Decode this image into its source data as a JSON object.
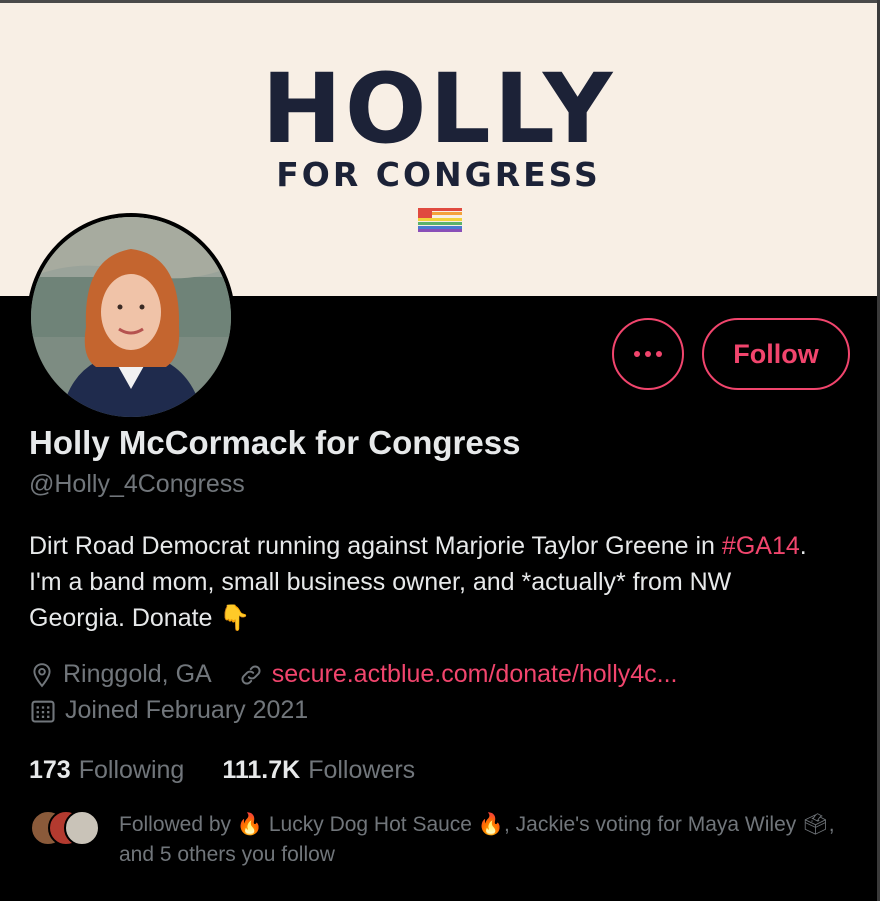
{
  "banner": {
    "title": "HOLLY",
    "subtitle": "FOR CONGRESS",
    "colors": {
      "text": "#1c2237",
      "background": "#f8efe5"
    }
  },
  "profile": {
    "name": "Holly McCormack for Congress",
    "handle": "@Holly_4Congress",
    "bio": {
      "part1": "Dirt Road Democrat running against Marjorie Taylor Greene in ",
      "hashtag": "#GA14",
      "part2": ". I'm a band mom, small business owner, and *actually* from NW Georgia. Donate ",
      "emoji": "👇"
    },
    "location": "Ringgold, GA",
    "website": "secure.actblue.com/donate/holly4c...",
    "joined": "Joined February 2021"
  },
  "actions": {
    "follow_label": "Follow",
    "more_icon": "more-dots-icon"
  },
  "stats": {
    "following_count": "173",
    "following_label": "Following",
    "followers_count": "111.7K",
    "followers_label": "Followers"
  },
  "followed_by": {
    "prefix": "Followed by ",
    "fire1": "🔥",
    "name1": " Lucky Dog Hot Sauce ",
    "fire2": "🔥",
    "name2": ", Jackie's voting for Maya Wiley ",
    "ballot": "🗳",
    "suffix": ", and 5 others you follow"
  },
  "colors": {
    "accent": "#f1456d",
    "muted": "#71767b",
    "text": "#e7e9ea"
  }
}
